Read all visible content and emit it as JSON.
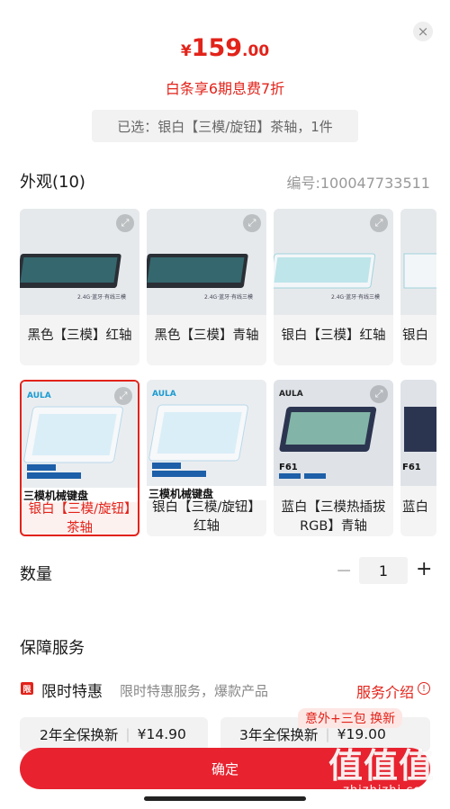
{
  "header": {
    "price_currency": "¥",
    "price_integer": "159",
    "price_decimal": ".00",
    "installment": "白条享6期息费7折",
    "selected": "已选：银白【三模/旋钮】茶轴，1件"
  },
  "appearance": {
    "title": "外观(10)",
    "sku_no": "编号:100047733511",
    "items": [
      {
        "label": "黑色【三模】红轴",
        "banner": ""
      },
      {
        "label": "黑色【三模】青轴",
        "banner": ""
      },
      {
        "label": "银白【三模】红轴",
        "banner": ""
      },
      {
        "label": "银白",
        "banner": ""
      },
      {
        "label": "银白【三模/旋钮】茶轴",
        "banner": "三模机械键盘"
      },
      {
        "label": "银白【三模/旋钮】红轴",
        "banner": "三模机械键盘"
      },
      {
        "label": "蓝白【三模热插拔RGB】青轴",
        "banner": ""
      },
      {
        "label": "蓝白",
        "banner": ""
      }
    ]
  },
  "quantity": {
    "label": "数量",
    "minus": "−",
    "value": "1",
    "plus": "+"
  },
  "service": {
    "title": "保障服务",
    "limited_badge": "限",
    "limited_title": "限时特惠",
    "limited_desc": "限时特惠服务，爆款产品",
    "intro": "服务介绍",
    "info": "!",
    "promo_tag": "意外+三包 换新",
    "options": [
      {
        "name": "2年全保换新",
        "price": "¥14.90"
      },
      {
        "name": "3年全保换新",
        "price": "¥19.00"
      }
    ]
  },
  "footer": {
    "confirm": "确定",
    "watermark_big": "值值值",
    "watermark_small": "zhizhizhi.com"
  },
  "colors": {
    "accent": "#e2231a",
    "confirm_bg": "#e8232f"
  }
}
